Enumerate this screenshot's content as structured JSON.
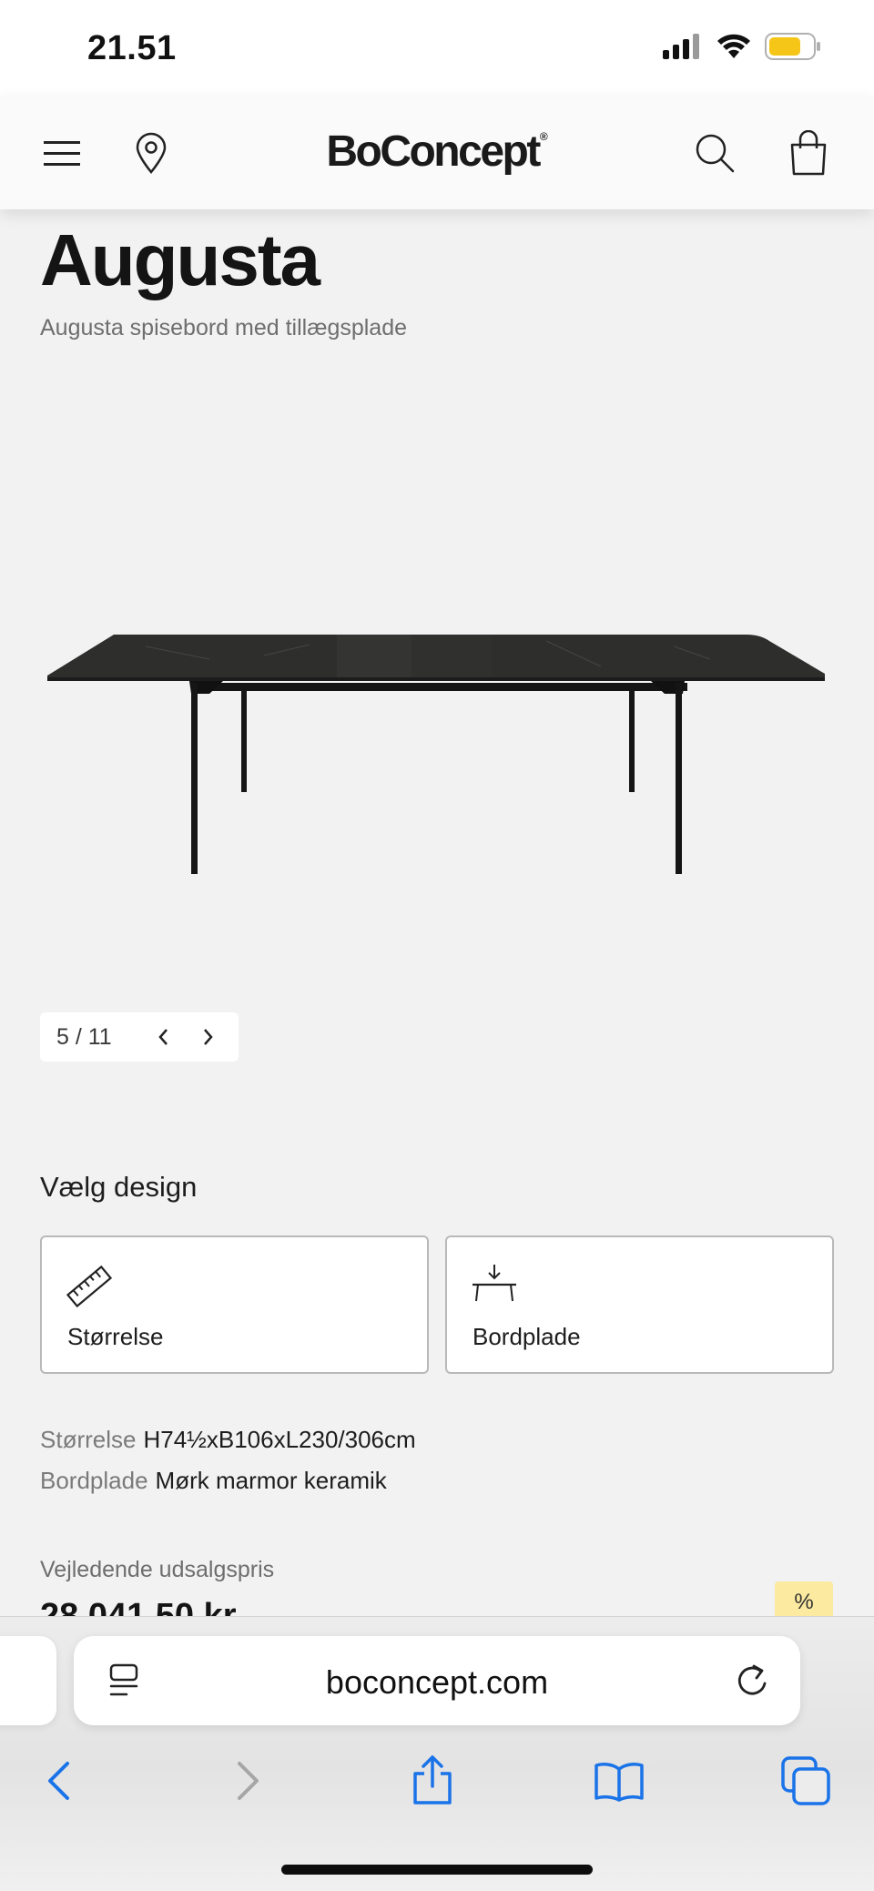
{
  "status_bar": {
    "time": "21.51"
  },
  "header": {
    "logo_text": "BoConcept",
    "logo_mark": "®",
    "icons": [
      "menu-icon",
      "location-pin-icon",
      "search-icon",
      "shopping-bag-icon"
    ]
  },
  "product": {
    "title": "Augusta",
    "subtitle": "Augusta spisebord med tillægsplade",
    "gallery": {
      "counter": "5 / 11"
    },
    "design": {
      "heading": "Vælg design",
      "options": [
        {
          "label": "Størrelse",
          "icon": "ruler-icon"
        },
        {
          "label": "Bordplade",
          "icon": "tabletop-icon"
        }
      ]
    },
    "specs": [
      {
        "key": "Størrelse",
        "value": "H74½xB106xL230/306cm"
      },
      {
        "key": "Bordplade",
        "value": "Mørk marmor keramik"
      }
    ],
    "price": {
      "label": "Vejledende udsalgspris",
      "value": "28.041,50 kr.",
      "badge": "%"
    }
  },
  "browser": {
    "url": "boconcept.com",
    "toolbar": [
      "back-icon",
      "forward-icon",
      "share-icon",
      "bookmarks-icon",
      "tabs-icon"
    ]
  },
  "colors": {
    "page_background": "#f2f2f2",
    "safari_accent": "#1a73e8",
    "discount_badge": "#fbeaa0"
  }
}
